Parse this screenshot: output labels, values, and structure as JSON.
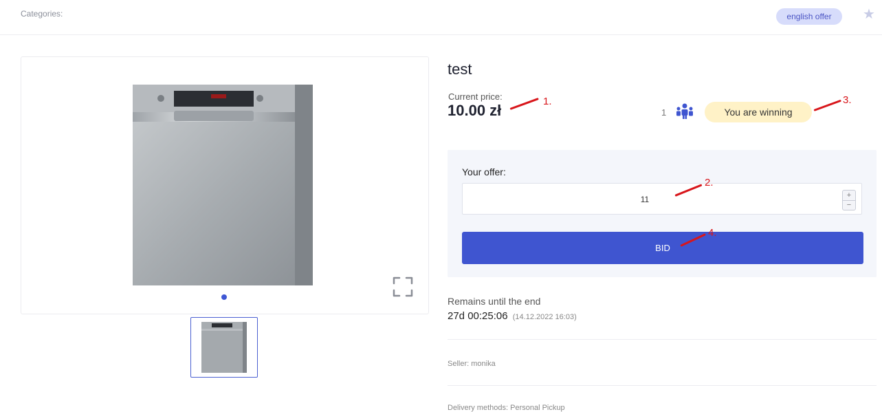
{
  "header": {
    "categories_label": "Categories:",
    "offer_type_badge": "english offer",
    "favorite_icon": "star-icon"
  },
  "gallery": {
    "main_image": "dishwasher-image",
    "fullscreen_icon": "fullscreen-icon",
    "slide_count": 1,
    "active_slide": 1,
    "thumbnail_image": "dishwasher-thumbnail"
  },
  "product": {
    "title": "test",
    "current_price_label": "Current price:",
    "current_price": "10.00 zł",
    "bidder_count": "1",
    "bidders_icon": "people-icon",
    "winning_status": "You are winning"
  },
  "bid_form": {
    "offer_label": "Your offer:",
    "offer_value": "11",
    "increment_label": "+",
    "decrement_label": "−",
    "bid_button_label": "BID"
  },
  "auction": {
    "remains_label": "Remains until the end",
    "remaining_time": "27d 00:25:06",
    "end_date": "(14.12.2022 16:03)"
  },
  "seller": {
    "label": "Seller:",
    "name": "monika"
  },
  "delivery": {
    "label": "Delivery methods:",
    "methods": "Personal Pickup"
  },
  "annotations": [
    "1.",
    "2.",
    "3.",
    "4."
  ],
  "colors": {
    "accent": "#3f55d0",
    "badge_bg": "#d7dcfb",
    "winning_bg": "#fff2c7",
    "annotation": "#d8161b",
    "panel_bg": "#f4f6fb"
  }
}
